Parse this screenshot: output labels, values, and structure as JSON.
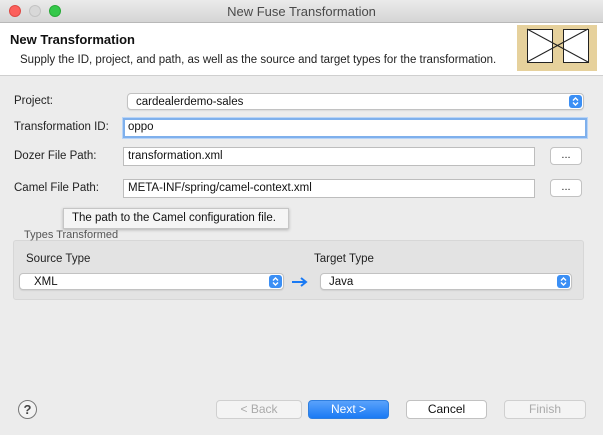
{
  "window": {
    "title": "New Fuse Transformation"
  },
  "header": {
    "title": "New Transformation",
    "description": "Supply the ID, project, and path, as well as the source and target types for the transformation."
  },
  "form": {
    "project_label": "Project:",
    "project_value": "cardealerdemo-sales",
    "transformation_id_label": "Transformation ID:",
    "transformation_id_value": "oppo",
    "dozer_label": "Dozer File Path:",
    "dozer_value": "transformation.xml",
    "dozer_browse": "...",
    "camel_label": "Camel File Path:",
    "camel_value": "META-INF/spring/camel-context.xml",
    "camel_browse": "...",
    "tooltip": "The path to the Camel configuration file."
  },
  "types": {
    "group_label": "Types Transformed",
    "source_label": "Source Type",
    "source_value": "XML",
    "target_label": "Target Type",
    "target_value": "Java"
  },
  "footer": {
    "help": "?",
    "back": "< Back",
    "next": "Next >",
    "cancel": "Cancel",
    "finish": "Finish"
  },
  "colors": {
    "accent": "#1a7af4",
    "banner": "#e6d19c"
  }
}
